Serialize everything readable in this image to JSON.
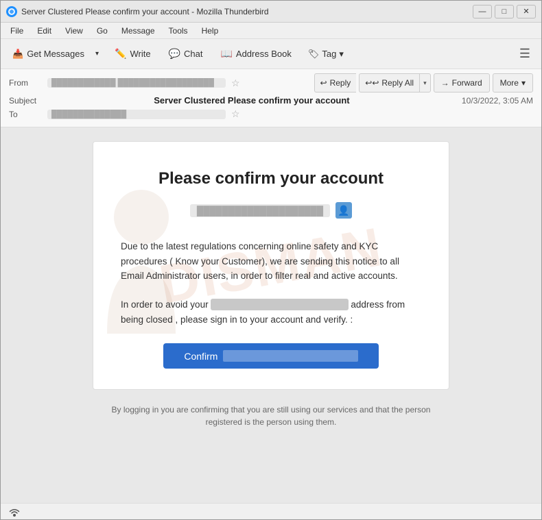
{
  "window": {
    "title": "Server Clustered Please confirm your account - Mozilla Thunderbird",
    "icon": "T"
  },
  "titlebar": {
    "minimize": "—",
    "maximize": "□",
    "close": "✕"
  },
  "menu": {
    "items": [
      "File",
      "Edit",
      "View",
      "Go",
      "Message",
      "Tools",
      "Help"
    ]
  },
  "toolbar": {
    "get_messages": "Get Messages",
    "write": "Write",
    "chat": "Chat",
    "address_book": "Address Book",
    "tag": "Tag"
  },
  "email_actions": {
    "reply": "Reply",
    "reply_all": "Reply All",
    "forward": "Forward",
    "more": "More"
  },
  "email_header": {
    "from_label": "From",
    "from_value": "████████████████████████████",
    "subject_label": "Subject",
    "subject_value": "Server Clustered Please confirm your account",
    "to_label": "To",
    "to_value": "██████████████",
    "date": "10/3/2022, 3:05 AM"
  },
  "email_body": {
    "title": "Please confirm your account",
    "recipient_email": "████████████████████",
    "paragraph1": "Due to the latest regulations concerning online safety and KYC procedures ( Know your Customer), we are sending this notice to all Email Administrator users, in order to filter real and active accounts.",
    "paragraph2_pre": "In order to avoid your",
    "paragraph2_address": "████████████████████",
    "paragraph2_post": "address from being closed  , please sign in to your account and verify. :",
    "confirm_btn": "Confirm",
    "confirm_url": "████████████████████",
    "footer": "By logging in you are confirming that you are still using our services and that the person registered is the person using them."
  },
  "watermark_text": "DISMAN",
  "status": {
    "wifi_icon": "wifi"
  }
}
